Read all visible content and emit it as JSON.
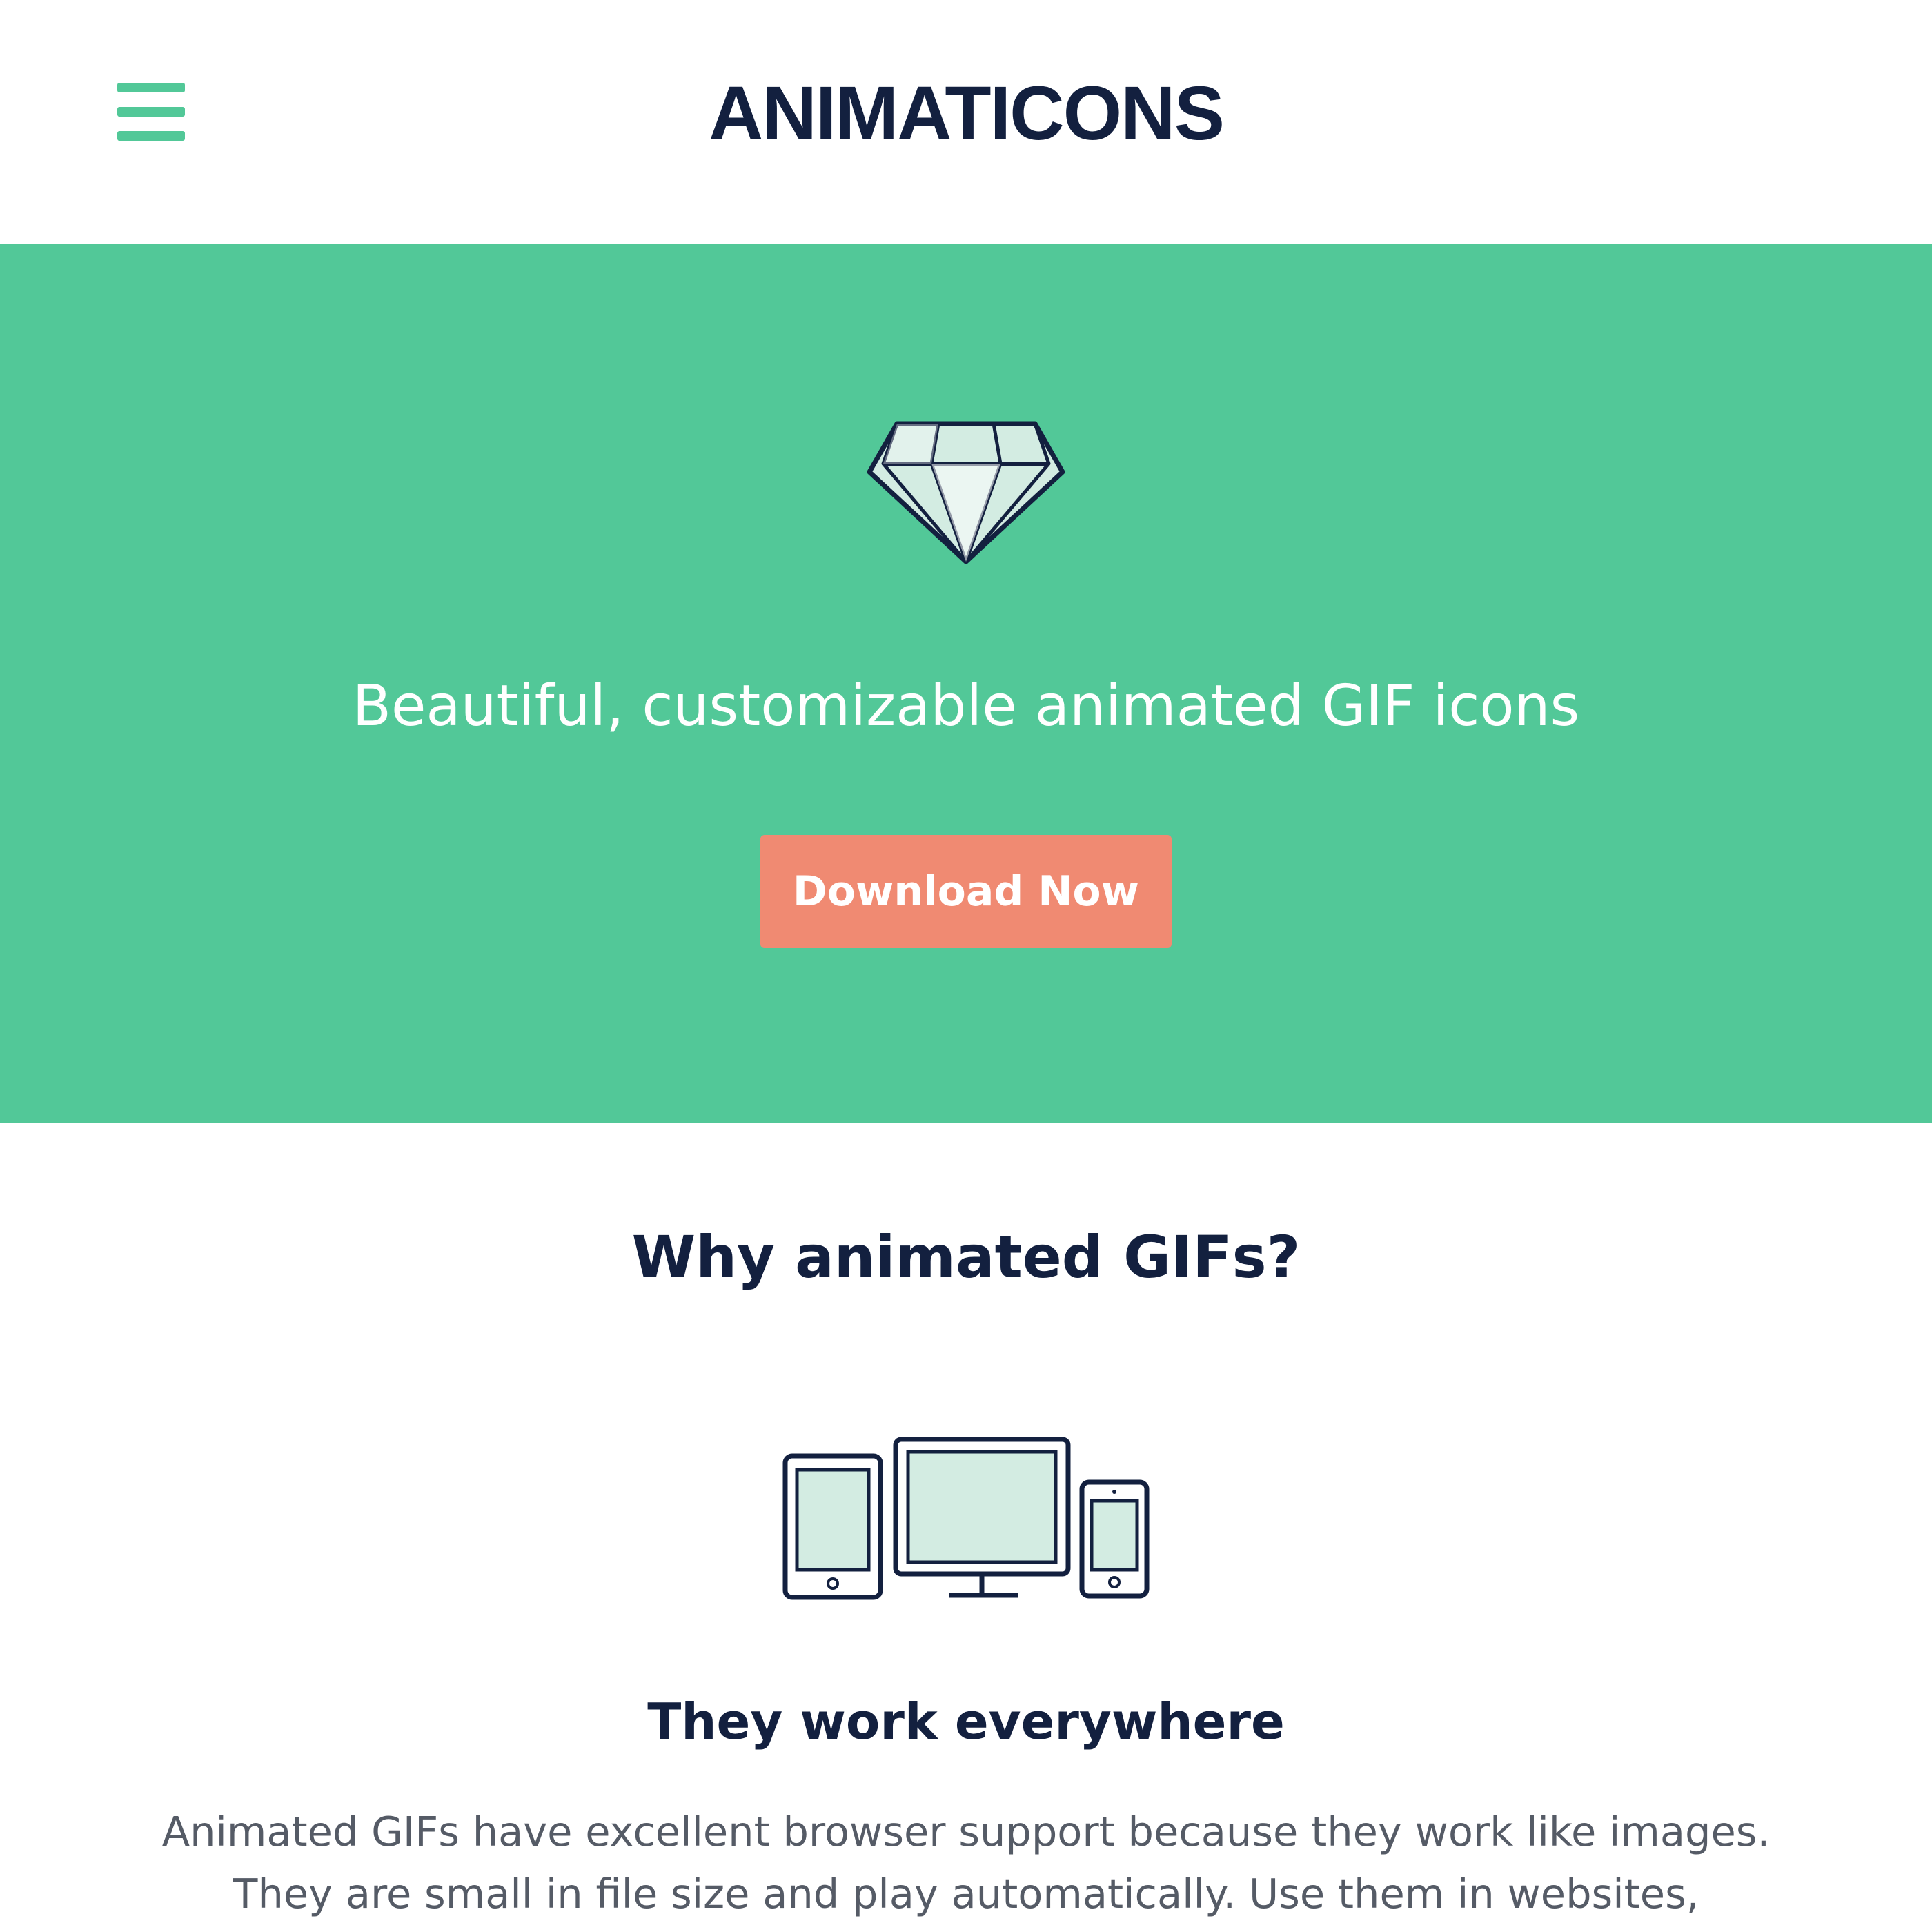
{
  "header": {
    "logo": "ANIMATICONS",
    "menu_icon": "hamburger-menu-icon"
  },
  "hero": {
    "icon": "diamond-icon",
    "tagline": "Beautiful, customizable animated GIF icons",
    "cta_label": "Download Now"
  },
  "why": {
    "heading": "Why animated GIFs?",
    "feature": {
      "icon": "devices-icon",
      "title": "They work everywhere",
      "description": "Animated GIFs have excellent browser support because they work like images. They are small in file size and play automatically. Use them in websites,"
    }
  },
  "colors": {
    "brand_green": "#52c898",
    "navy": "#13203f",
    "cta_salmon": "#f08a72",
    "icon_fill": "#d3ece2",
    "body_text": "#555b66"
  }
}
